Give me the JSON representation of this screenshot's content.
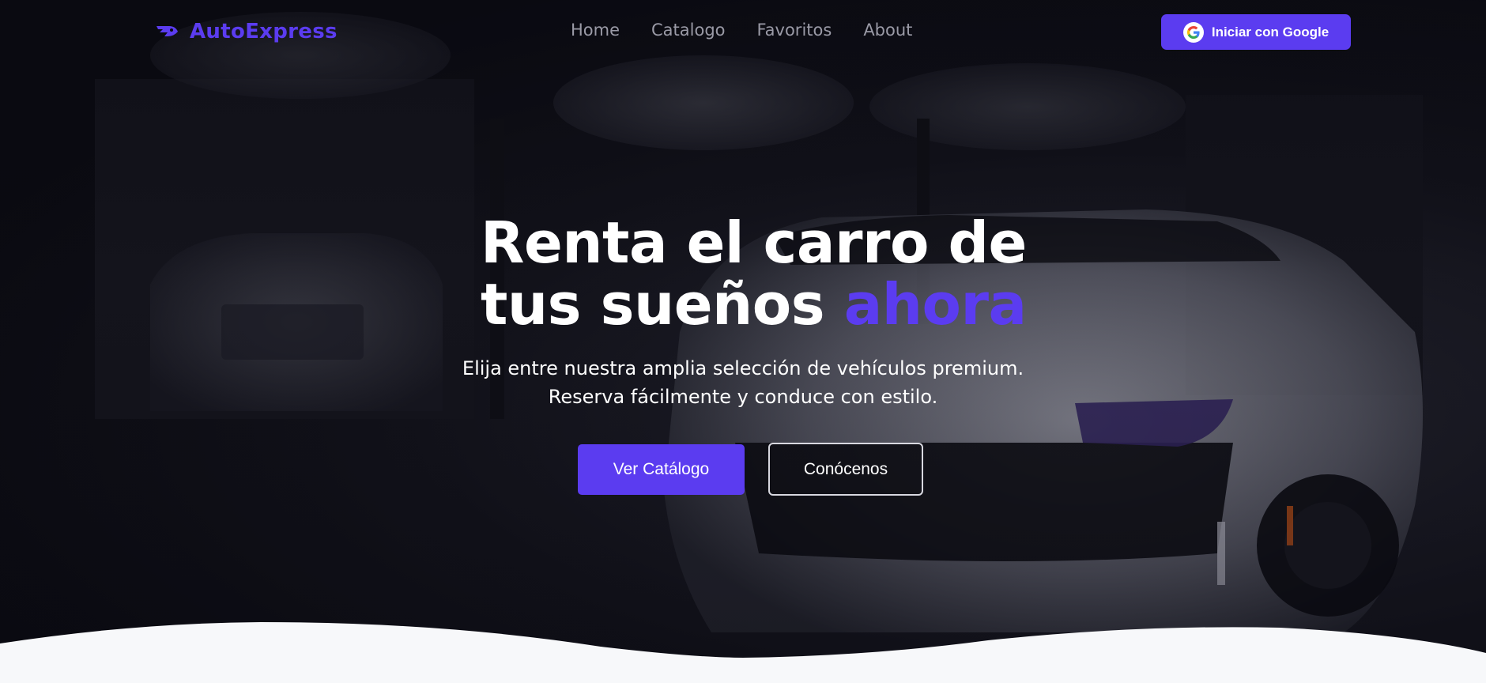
{
  "brand": {
    "name": "AutoExpress",
    "icon": "car-speed-icon"
  },
  "nav": {
    "links": [
      "Home",
      "Catalogo",
      "Favoritos",
      "About"
    ]
  },
  "auth": {
    "google_label": "Iniciar con Google",
    "icon": "google-icon"
  },
  "hero": {
    "title_line1": "Renta el carro de",
    "title_line2": "tus sueños",
    "title_accent": "ahora",
    "subtitle_line1": "Elija entre nuestra amplia selección de vehículos premium.",
    "subtitle_line2": "Reserva fácilmente y conduce con estilo.",
    "primary_cta": "Ver Catálogo",
    "secondary_cta": "Conócenos"
  },
  "colors": {
    "accent": "#5b3cf0",
    "nav_text": "#9a9aa6",
    "background": "#0b0b12",
    "wave": "#f7f8fa"
  }
}
